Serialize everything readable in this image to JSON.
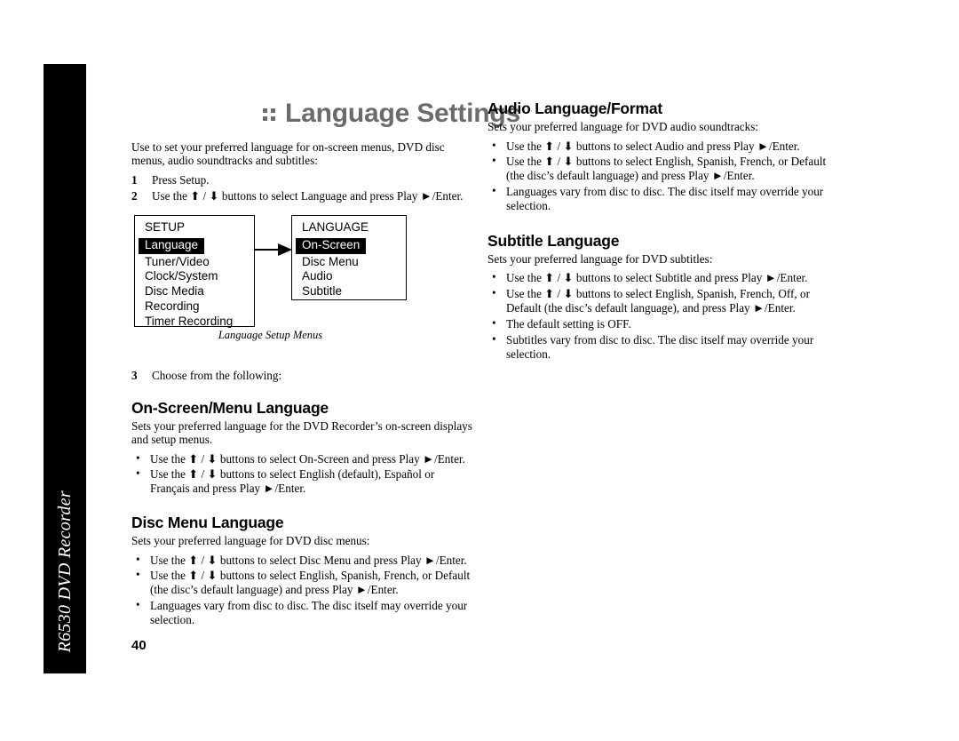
{
  "sidebar": {
    "product_label": "R6530 DVD Recorder"
  },
  "page": {
    "number": "40",
    "title": ":: Language Settings",
    "title_text": "Language Settings",
    "intro": "Use to set your preferred language for on-screen menus, DVD disc menus, audio soundtracks and subtitles:",
    "steps": [
      {
        "num": "1",
        "text": "Press Setup."
      },
      {
        "num": "2",
        "text": "Use the ⬆ / ⬇ buttons to select Language and press Play ►/Enter."
      }
    ],
    "step3": {
      "num": "3",
      "text": "Choose from the following:"
    }
  },
  "diagram": {
    "caption": "Language Setup Menus",
    "arrow_icon": "right-arrow-icon",
    "setup_menu": {
      "title": "SETUP",
      "items": [
        {
          "label": "Language",
          "highlighted": true
        },
        {
          "label": "Tuner/Video",
          "highlighted": false
        },
        {
          "label": "Clock/System",
          "highlighted": false
        },
        {
          "label": "Disc Media",
          "highlighted": false
        },
        {
          "label": "Recording",
          "highlighted": false
        },
        {
          "label": "Timer Recording",
          "highlighted": false
        }
      ]
    },
    "language_menu": {
      "title": "LANGUAGE",
      "items": [
        {
          "label": "On-Screen",
          "highlighted": true
        },
        {
          "label": "Disc Menu",
          "highlighted": false
        },
        {
          "label": "Audio",
          "highlighted": false
        },
        {
          "label": "Subtitle",
          "highlighted": false
        }
      ]
    }
  },
  "sections": {
    "on_screen": {
      "heading": "On-Screen/Menu Language",
      "intro": "Sets your preferred language for the DVD Recorder’s on-screen displays and setup menus.",
      "bullets": [
        "Use the ⬆ / ⬇ buttons to select On-Screen and press Play ►/Enter.",
        "Use the ⬆ / ⬇ buttons to select English (default), Español or Français and press Play ►/Enter."
      ]
    },
    "disc_menu": {
      "heading": "Disc Menu Language",
      "intro": "Sets your preferred language for DVD disc menus:",
      "bullets": [
        "Use the ⬆ / ⬇ buttons to select Disc Menu and press Play ►/Enter.",
        "Use the ⬆ / ⬇ buttons to select English, Spanish, French, or Default (the disc’s default language) and press Play ►/Enter.",
        "Languages vary from disc to disc. The disc itself may override your selection."
      ]
    },
    "audio": {
      "heading": "Audio Language/Format",
      "intro": "Sets your preferred language for DVD audio soundtracks:",
      "bullets": [
        "Use the ⬆ / ⬇ buttons to select Audio and press Play ►/Enter.",
        "Use the ⬆ / ⬇ buttons to select English, Spanish, French, or Default (the disc’s default language) and press Play ►/Enter.",
        "Languages vary from disc to disc. The disc itself may override your selection."
      ]
    },
    "subtitle": {
      "heading": "Subtitle Language",
      "intro": "Sets your preferred language for DVD subtitles:",
      "bullets": [
        "Use the ⬆ / ⬇ buttons to select Subtitle and press Play ►/Enter.",
        "Use the ⬆ / ⬇ buttons to select English, Spanish, French, Off, or Default (the disc’s default language), and press Play ►/Enter.",
        "The default setting is OFF.",
        "Subtitles vary from disc to disc. The disc itself may override your selection."
      ]
    }
  },
  "bullet_char": "•",
  "colors": {
    "title": "#6b6b6b",
    "sidebar": "#000000",
    "text": "#000000",
    "highlight_bg": "#000000",
    "highlight_fg": "#ffffff"
  }
}
